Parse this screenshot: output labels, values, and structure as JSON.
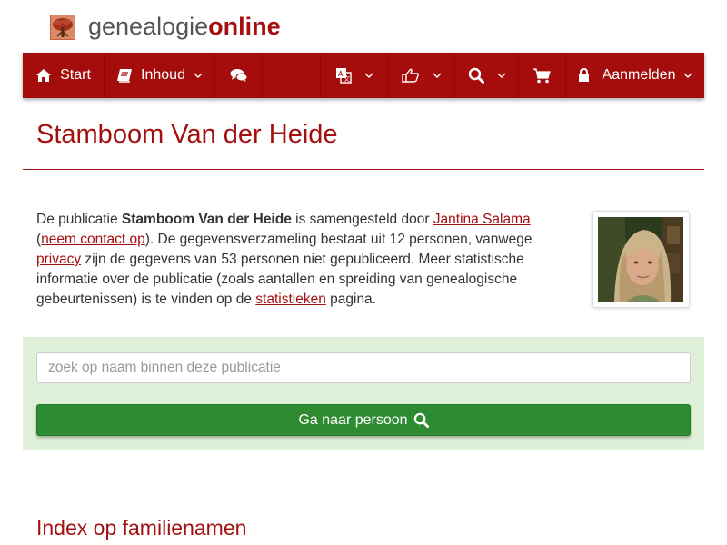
{
  "logo": {
    "text_light": "genealogie",
    "text_bold": "online"
  },
  "nav": {
    "start_label": "Start",
    "inhoud_label": "Inhoud",
    "aanmelden_label": "Aanmelden"
  },
  "page": {
    "title": "Stamboom Van der Heide",
    "intro": {
      "p1": "De publicatie ",
      "publication_name": "Stamboom Van der Heide",
      "p2": " is samengesteld door ",
      "author_link": "Jantina Salama",
      "p3": " (",
      "contact_link": "neem contact op",
      "p4": "). De gegevensverzameling bestaat uit 12 personen, vanwege ",
      "privacy_link": "privacy",
      "p5": " zijn de gegevens van 53 personen niet gepubliceerd. Meer statistische informatie over de publicatie (zoals aantallen en spreiding van genealogische gebeurtenissen) is te vinden op de ",
      "stats_link": "statistieken",
      "p6": " pagina."
    }
  },
  "search": {
    "placeholder": "zoek op naam binnen deze publicatie",
    "value": "",
    "button_label": "Ga naar persoon"
  },
  "index": {
    "title": "Index op familienamen"
  },
  "colors": {
    "brand": "#a40f0f",
    "nav_bg": "#a50d0d",
    "panel_bg": "#dff0d8",
    "button_bg": "#2e8b32"
  },
  "icons": [
    "tree-logo-icon",
    "home-icon",
    "book-icon",
    "comments-icon",
    "language-icon",
    "thumbs-up-icon",
    "search-icon",
    "cart-icon",
    "lock-icon",
    "chevron-down-icon"
  ]
}
